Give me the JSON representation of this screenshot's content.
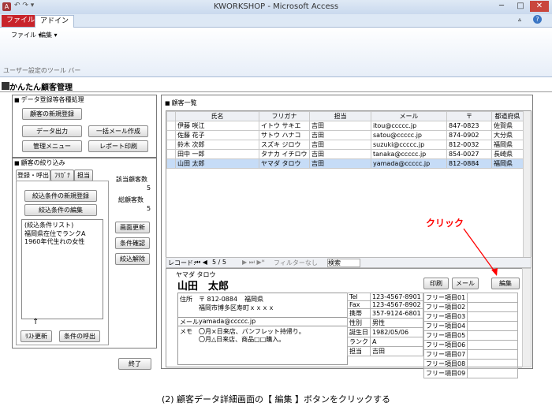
{
  "window": {
    "title": "KWORKSHOP - Microsoft Access"
  },
  "ribbon": {
    "tab_file": "ファイル",
    "tab_addin": "アドイン",
    "menu_file": "ファイル ▾",
    "menu_edit": "編集 ▾",
    "toolbar_label": "ユーザー設定のツール バー"
  },
  "app": {
    "title": "かんたん顧客管理"
  },
  "left": {
    "section1_title": "データ登録等各種処理",
    "btn_new_customer": "顧客の新規登録",
    "btn_export": "データ出力",
    "btn_bulk_mail": "一括メール作成",
    "btn_manage_menu": "管理メニュー",
    "btn_report_print": "レポート印刷",
    "section2_title": "顧客の絞り込み",
    "tabs": [
      "登録・呼出",
      "ﾌﾘｶﾞﾅ",
      "担当"
    ],
    "btn_new_filter": "絞込条件の新規登録",
    "btn_edit_filter": "絞込条件の編集",
    "filter_list_title": "(絞込条件リスト)",
    "filter_items": [
      "福岡県在住でランクA",
      "1960年代生れの女性"
    ],
    "arrow": "↑",
    "btn_list_refresh": "ﾘｽﾄ更新",
    "btn_call_filter": "条件の呼出",
    "count_label": "該当顧客数",
    "count_value": "5",
    "total_label": "総顧客数",
    "total_value": "5",
    "btn_screen_refresh": "画面更新",
    "btn_check_filter": "条件確認",
    "btn_clear_filter": "絞込解除",
    "btn_exit": "終了"
  },
  "list": {
    "title": "顧客一覧",
    "headers": [
      "氏名",
      "フリガナ",
      "担当",
      "メール",
      "〒",
      "都道府県"
    ],
    "rows": [
      [
        "伊藤 咲江",
        "イトウ サキエ",
        "吉田",
        "itou@ccccc.jp",
        "847-0823",
        "佐賀県"
      ],
      [
        "佐藤 花子",
        "サトウ ハナコ",
        "吉田",
        "satou@ccccc.jp",
        "874-0902",
        "大分県"
      ],
      [
        "鈴木 次郎",
        "スズキ ジロウ",
        "吉田",
        "suzuki@ccccc.jp",
        "812-0032",
        "福岡県"
      ],
      [
        "田中 一郎",
        "タナカ イチロウ",
        "吉田",
        "tanaka@ccccc.jp",
        "854-0027",
        "長崎県"
      ],
      [
        "山田 太郎",
        "ヤマダ タロウ",
        "吉田",
        "yamada@ccccc.jp",
        "812-0884",
        "福岡県"
      ]
    ],
    "selected_index": 4,
    "nav_label": "レコード:",
    "nav_pos": "5 / 5",
    "nav_filter": "フィルターなし",
    "nav_search": "検索"
  },
  "detail": {
    "kana": "ヤマダ タロウ",
    "name": "山田　太郎",
    "btn_print": "印刷",
    "btn_mail": "メール",
    "btn_edit": "編集",
    "address_label": "住所",
    "zip": "〒 812-0884",
    "pref": "福岡県",
    "address": "福岡市博多区寿町ｘｘｘｘ",
    "mail_label": "メール",
    "mail": "yamada@ccccc.jp",
    "memo_label": "メモ",
    "memo_lines": [
      "〇月×日来店、パンフレット持帰り。",
      "〇月△日来店、商品□□購入。"
    ],
    "fields": [
      [
        "Tel",
        "123-4567-8901"
      ],
      [
        "Fax",
        "123-4567-8902"
      ],
      [
        "携帯",
        "357-9124-6801"
      ],
      [
        "性別",
        "男性"
      ],
      [
        "誕生日",
        "1982/05/06"
      ],
      [
        "ランク",
        "A"
      ],
      [
        "担当",
        "吉田"
      ]
    ],
    "free_items": [
      "フリー項目01",
      "フリー項目02",
      "フリー項目03",
      "フリー項目04",
      "フリー項目05",
      "フリー項目06",
      "フリー項目07",
      "フリー項目08",
      "フリー項目09"
    ]
  },
  "annotation": {
    "click": "クリック"
  },
  "caption": "(2) 顧客データ詳細画面の【 編集 】ボタンをクリックする",
  "colors": {
    "file_tab": "#c8242b",
    "selected_row": "#c6dcf7",
    "annotation": "#ff0000"
  }
}
